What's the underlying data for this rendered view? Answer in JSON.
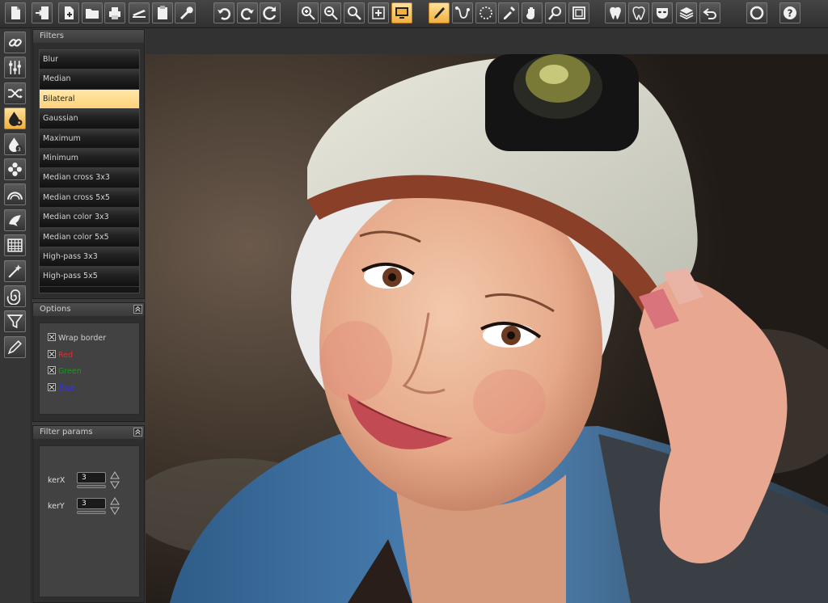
{
  "toolbar": {
    "buttons": [
      {
        "id": "new",
        "icon": "new-document-icon"
      },
      {
        "id": "import",
        "icon": "import-icon"
      },
      {
        "id": "add",
        "icon": "add-image-icon"
      },
      {
        "id": "open",
        "icon": "open-folder-icon"
      },
      {
        "id": "print",
        "icon": "print-icon"
      },
      {
        "id": "scan",
        "icon": "scanner-icon"
      },
      {
        "id": "clipboard",
        "icon": "clipboard-icon"
      },
      {
        "id": "settings",
        "icon": "wrench-icon"
      },
      {
        "id": "undo",
        "icon": "undo-icon"
      },
      {
        "id": "redo",
        "icon": "redo-icon"
      },
      {
        "id": "refresh",
        "icon": "refresh-icon"
      },
      {
        "id": "zoom_in",
        "icon": "zoom-in-icon"
      },
      {
        "id": "zoom_out",
        "icon": "zoom-out-icon"
      },
      {
        "id": "zoom",
        "icon": "magnifier-icon"
      },
      {
        "id": "fit",
        "icon": "fit-screen-icon"
      },
      {
        "id": "fullscreen",
        "icon": "monitor-icon",
        "active": true
      },
      {
        "id": "brush",
        "icon": "brush-icon",
        "active": true
      },
      {
        "id": "path",
        "icon": "path-icon"
      },
      {
        "id": "lasso",
        "icon": "ellipse-select-icon"
      },
      {
        "id": "picker",
        "icon": "eyedropper-icon"
      },
      {
        "id": "hand",
        "icon": "hand-icon"
      },
      {
        "id": "loupe",
        "icon": "loupe-icon"
      },
      {
        "id": "crop",
        "icon": "crop-icon"
      },
      {
        "id": "teeth1",
        "icon": "tooth-icon"
      },
      {
        "id": "teeth2",
        "icon": "tooth-outline-icon"
      },
      {
        "id": "mask",
        "icon": "mask-icon"
      },
      {
        "id": "layers",
        "icon": "layers-icon"
      },
      {
        "id": "back",
        "icon": "return-icon"
      },
      {
        "id": "record",
        "icon": "circle-icon"
      },
      {
        "id": "help",
        "icon": "help-icon"
      }
    ]
  },
  "left_tools": [
    {
      "icon": "link-icon"
    },
    {
      "icon": "sliders-icon"
    },
    {
      "icon": "shuffle-icon"
    },
    {
      "icon": "drop-gear-icon",
      "active": true
    },
    {
      "icon": "drop-number-icon"
    },
    {
      "icon": "flower-icon"
    },
    {
      "icon": "rainbow-icon"
    },
    {
      "icon": "bird-icon"
    },
    {
      "icon": "grid-icon"
    },
    {
      "icon": "magic-wand-icon"
    },
    {
      "icon": "spiral-icon"
    },
    {
      "icon": "funnel-icon"
    },
    {
      "icon": "pencil-icon"
    }
  ],
  "filters": {
    "title": "Filters",
    "items": [
      "Blur",
      "Median",
      "Bilateral",
      "Gaussian",
      "Maximum",
      "Minimum",
      "Median cross 3x3",
      "Median cross 5x5",
      "Median color 3x3",
      "Median color 5x5",
      "High-pass 3x3",
      "High-pass 5x5"
    ],
    "selected": "Bilateral"
  },
  "options": {
    "title": "Options",
    "items": [
      {
        "label": "Wrap border",
        "color": "#cfcfcf",
        "checked": true
      },
      {
        "label": "Red",
        "color": "#ff2020",
        "checked": true
      },
      {
        "label": "Green",
        "color": "#10a010",
        "checked": true
      },
      {
        "label": "Blue",
        "color": "#3030ff",
        "checked": true
      }
    ]
  },
  "params": {
    "title": "Filter params",
    "fields": [
      {
        "label": "kerX",
        "value": "3"
      },
      {
        "label": "kerY",
        "value": "3"
      }
    ]
  },
  "colors": {
    "accent": "#ffd27a",
    "panel": "#2e2e2e"
  }
}
